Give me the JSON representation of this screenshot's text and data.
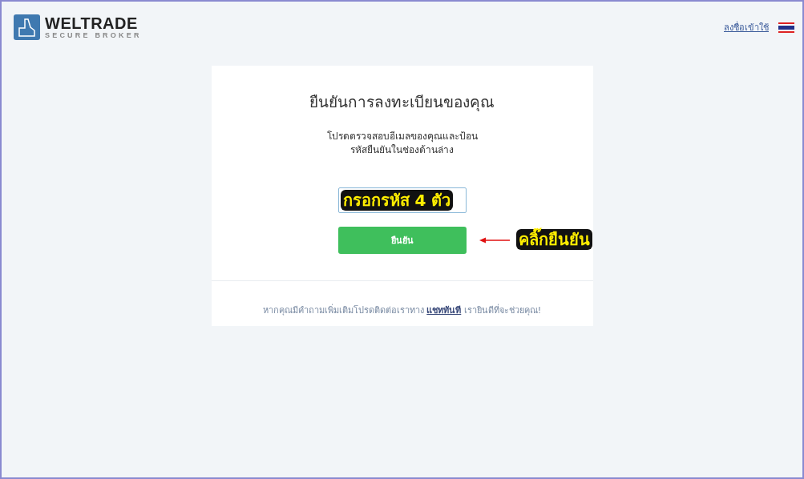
{
  "header": {
    "logo": {
      "name": "WELTRADE",
      "tagline": "SECURE BROKER"
    },
    "login_link": "ลงชื่อเข้าใช้"
  },
  "card": {
    "title": "ยืนยันการลงทะเบียนของคุณ",
    "instructions": "โปรดตรวจสอบอีเมลของคุณและป้อน\nรหัสยืนยันในช่องด้านล่าง",
    "confirm_button": "ยืนยัน",
    "help_text": "หากคุณมีคำถามเพิ่มเติมโปรดติดต่อเราทาง",
    "help_link": "แชททันที",
    "help_suffix": "เรายินดีที่จะช่วยคุณ!"
  },
  "annotations": [
    {
      "kind": "field-note",
      "text": "กรอกรหัส 4 ตัว"
    },
    {
      "kind": "button-note",
      "text": "คลิ๊กยืนยัน"
    }
  ]
}
